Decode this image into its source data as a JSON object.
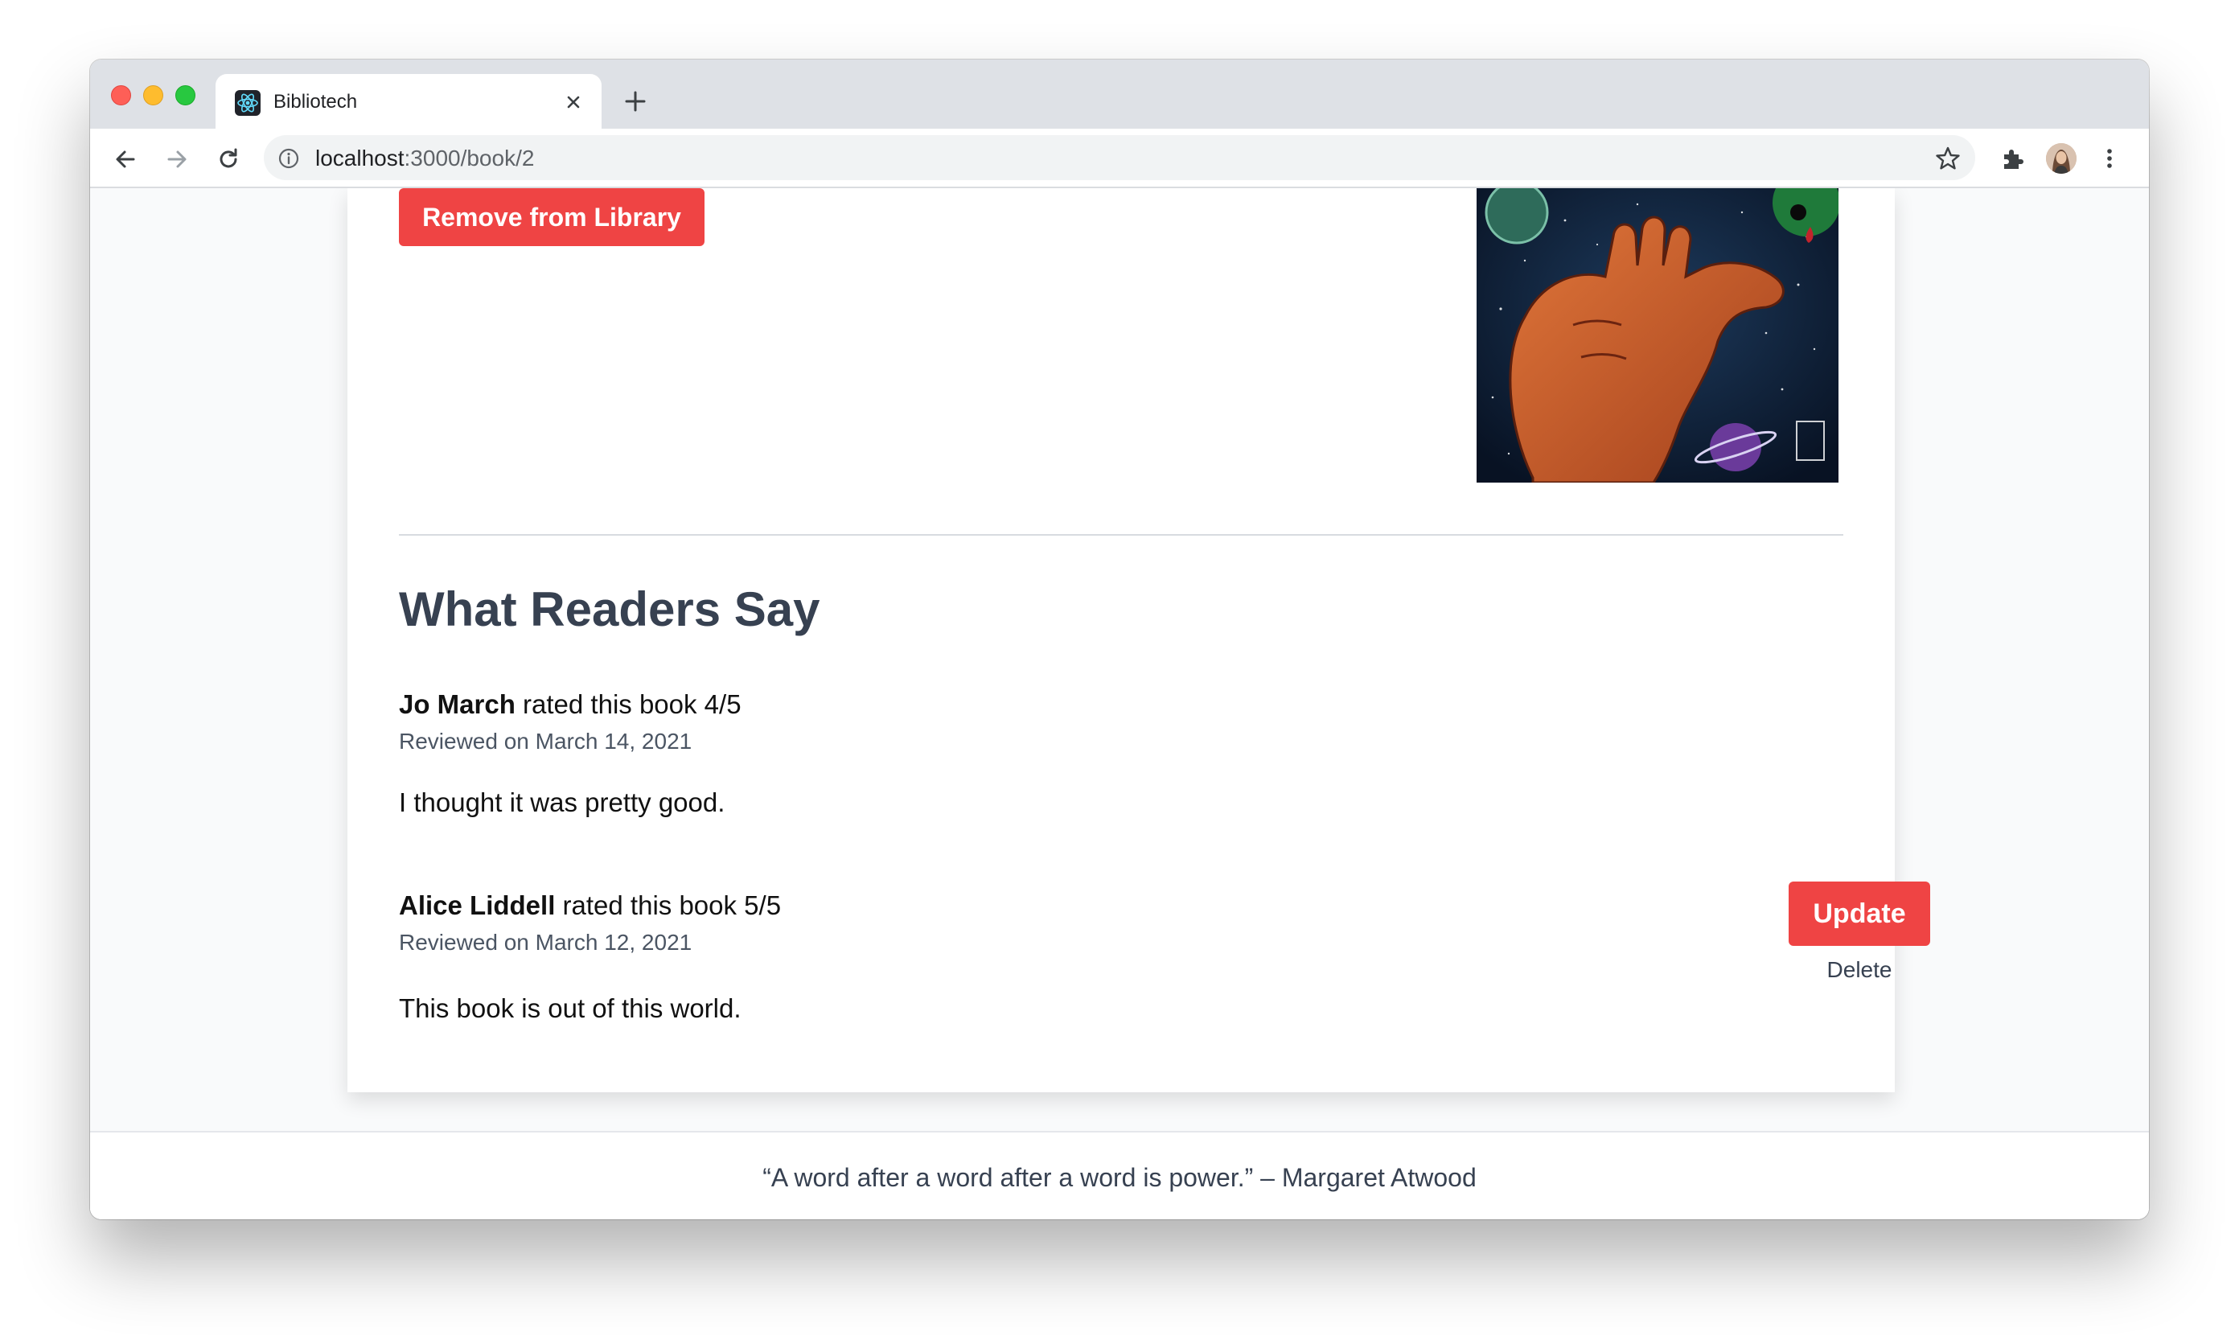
{
  "browser": {
    "tab_title": "Bibliotech",
    "url_host": "localhost",
    "url_path": ":3000/book/2"
  },
  "page": {
    "remove_button_label": "Remove from Library",
    "section_heading": "What Readers Say",
    "reviews": [
      {
        "reviewer": "Jo March",
        "rating_text": " rated this book 4/5",
        "date": "Reviewed on March 14, 2021",
        "body": "I thought it was pretty good."
      },
      {
        "reviewer": "Alice Liddell",
        "rating_text": " rated this book 5/5",
        "date": "Reviewed on March 12, 2021",
        "body": "This book is out of this world.",
        "update_label": "Update",
        "delete_label": "Delete"
      }
    ]
  },
  "footer": {
    "quote": "“A word after a word after a word is power.” – Margaret Atwood"
  },
  "colors": {
    "accent": "#ef4444",
    "heading": "#374151",
    "page_bg": "#f9fafb"
  }
}
